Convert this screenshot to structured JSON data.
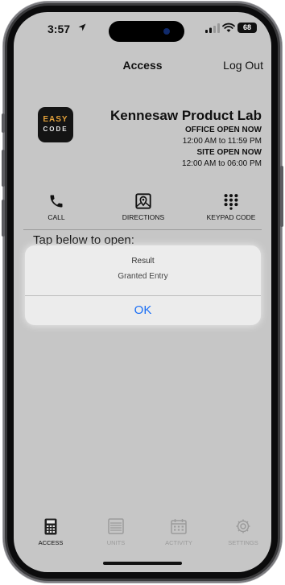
{
  "status_bar": {
    "time": "3:57",
    "battery": "68"
  },
  "header": {
    "title": "Access",
    "logout_label": "Log Out"
  },
  "logo": {
    "line1": "EASY",
    "line2": "CODE"
  },
  "site": {
    "name": "Kennesaw Product Lab",
    "office_status": "OFFICE OPEN NOW",
    "office_hours": "12:00 AM to 11:59 PM",
    "site_status": "SITE OPEN NOW",
    "site_hours": "12:00 AM to 06:00 PM"
  },
  "actions": [
    {
      "label": "CALL",
      "icon": "phone-icon"
    },
    {
      "label": "DIRECTIONS",
      "icon": "map-pin-icon"
    },
    {
      "label": "KEYPAD CODE",
      "icon": "keypad-icon"
    }
  ],
  "instruction": "Tap below to open:",
  "alert": {
    "title": "Result",
    "message": "Granted Entry",
    "ok_label": "OK"
  },
  "tabs": [
    {
      "label": "ACCESS",
      "icon": "access-keypad-icon",
      "active": true
    },
    {
      "label": "UNITS",
      "icon": "units-icon",
      "active": false
    },
    {
      "label": "ACTIVITY",
      "icon": "calendar-icon",
      "active": false
    },
    {
      "label": "SETTINGS",
      "icon": "gear-icon",
      "active": false
    }
  ],
  "colors": {
    "accent": "#1a6ef5",
    "logo_orange": "#e3a13a",
    "screen_bg": "#c6c6c6"
  }
}
